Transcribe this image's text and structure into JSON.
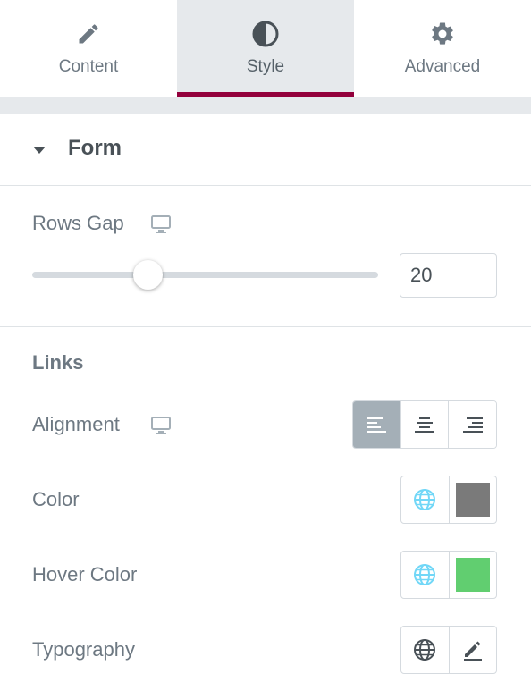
{
  "tabs": [
    {
      "label": "Content",
      "icon": "pencil-icon",
      "active": false
    },
    {
      "label": "Style",
      "icon": "contrast-icon",
      "active": true
    },
    {
      "label": "Advanced",
      "icon": "gear-icon",
      "active": false
    }
  ],
  "accent_color": "#93003c",
  "section": {
    "title": "Form",
    "expanded": true
  },
  "rows_gap": {
    "label": "Rows Gap",
    "device_icon": "desktop-icon",
    "value": "20",
    "slider_fraction": 0.33
  },
  "links": {
    "heading": "Links",
    "alignment": {
      "label": "Alignment",
      "device_icon": "desktop-icon",
      "options": [
        "left",
        "center",
        "right"
      ],
      "selected": "left"
    },
    "color": {
      "label": "Color",
      "global_icon": "globe-icon",
      "swatch": "#7a7a7a"
    },
    "hover_color": {
      "label": "Hover Color",
      "global_icon": "globe-icon",
      "swatch": "#61ce70"
    },
    "typography": {
      "label": "Typography",
      "global_icon": "globe-icon",
      "edit_icon": "pencil-icon"
    }
  }
}
